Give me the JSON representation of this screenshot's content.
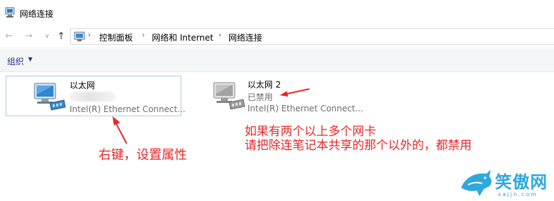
{
  "window": {
    "title": "网络连接"
  },
  "navigation": {
    "back_icon": "back-arrow-icon",
    "forward_icon": "forward-arrow-icon",
    "up_icon": "up-arrow-icon",
    "breadcrumbs": [
      "控制面板",
      "网络和 Internet",
      "网络连接"
    ]
  },
  "toolbar": {
    "organize_label": "组织"
  },
  "adapters": [
    {
      "name": "以太网",
      "status": "",
      "status_blurred": true,
      "device": "Intel(R) Ethernet Connect...",
      "selected": true,
      "icon": "network-adapter-icon"
    },
    {
      "name": "以太网 2",
      "status": "已禁用",
      "device": "Intel(R) Ethernet Connect...",
      "selected": false,
      "icon": "network-adapter-disabled-icon"
    }
  ],
  "annotations": {
    "right_click": "右键，设置属性",
    "note_line1": "如果有两个以上多个网卡",
    "note_line2": "请把除连笔记本共享的那个以外的，都禁用"
  },
  "watermark": {
    "brand": "笑傲网",
    "url": "xajjn.com"
  },
  "colors": {
    "annotation_red": "#e8262a",
    "selection_border": "#a9cdea",
    "toolbar_bg": "#f5f6f7",
    "watermark_blue": "#2ea8de"
  }
}
